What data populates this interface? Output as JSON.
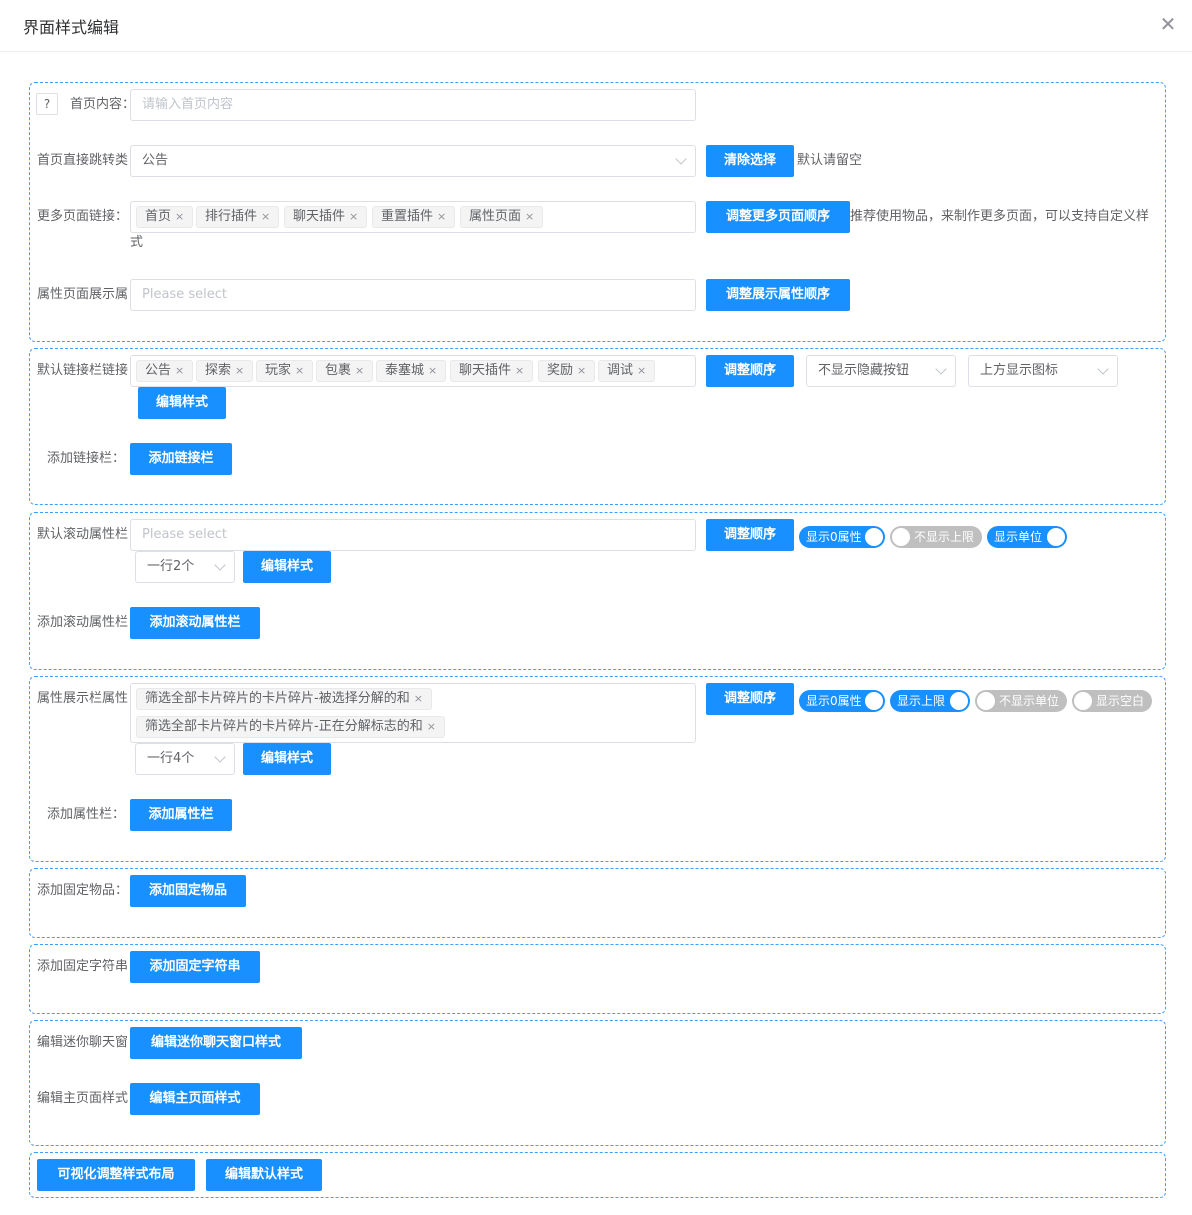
{
  "dialog": {
    "title": "界面样式编辑",
    "close_icon": "close-icon"
  },
  "s1": {
    "help": "?",
    "home_label": "首页内容：",
    "home_placeholder": "请输入首页内容",
    "jump_label": "首页直接跳转类",
    "jump_value": "公告",
    "clear_btn": "清除选择",
    "jump_hint": "默认请留空",
    "more_label": "更多页面链接：",
    "more_tags": [
      "首页",
      "排行插件",
      "聊天插件",
      "重置插件",
      "属性页面"
    ],
    "more_btn": "调整更多页面顺序",
    "more_hint": "推荐使用物品，来制作更多页面，可以支持自定义样式",
    "attr_label": "属性页面展示属",
    "attr_placeholder": "Please select",
    "attr_btn": "调整展示属性顺序"
  },
  "s2": {
    "link_label": "默认链接栏链接",
    "link_tags": [
      "公告",
      "探索",
      "玩家",
      "包裹",
      "泰塞城",
      "聊天插件",
      "奖励",
      "调试"
    ],
    "order_btn": "调整顺序",
    "hide_select": "不显示隐藏按钮",
    "icon_select": "上方显示图标",
    "edit_btn": "编辑样式",
    "add_label": "添加链接栏：",
    "add_btn": "添加链接栏"
  },
  "s3": {
    "label": "默认滚动属性栏",
    "placeholder": "Please select",
    "order_btn": "调整顺序",
    "toggles": [
      {
        "label": "显示0属性",
        "on": true
      },
      {
        "label": "不显示上限",
        "on": false
      },
      {
        "label": "显示单位",
        "on": true
      }
    ],
    "per_row": "一行2个",
    "edit_btn": "编辑样式",
    "add_label": "添加滚动属性栏",
    "add_btn": "添加滚动属性栏"
  },
  "s4": {
    "label": "属性展示栏属性",
    "tags": [
      "筛选全部卡片碎片的卡片碎片-被选择分解的和",
      "筛选全部卡片碎片的卡片碎片-正在分解标志的和"
    ],
    "order_btn": "调整顺序",
    "toggles": [
      {
        "label": "显示0属性",
        "on": true
      },
      {
        "label": "显示上限",
        "on": true
      },
      {
        "label": "不显示单位",
        "on": false
      },
      {
        "label": "显示空白",
        "on": false
      }
    ],
    "per_row": "一行4个",
    "edit_btn": "编辑样式",
    "add_label": "添加属性栏：",
    "add_btn": "添加属性栏"
  },
  "s5": {
    "label": "添加固定物品：",
    "btn": "添加固定物品"
  },
  "s6": {
    "label": "添加固定字符串",
    "btn": "添加固定字符串"
  },
  "s7": {
    "mini_label": "编辑迷你聊天窗",
    "mini_btn": "编辑迷你聊天窗口样式",
    "main_label": "编辑主页面样式",
    "main_btn": "编辑主页面样式"
  },
  "s8": {
    "visual_btn": "可视化调整样式布局",
    "default_btn": "编辑默认样式"
  },
  "colors": {
    "primary": "#1890ff",
    "border_dashed": "#409eff",
    "toggle_off": "#bfbfbf"
  }
}
